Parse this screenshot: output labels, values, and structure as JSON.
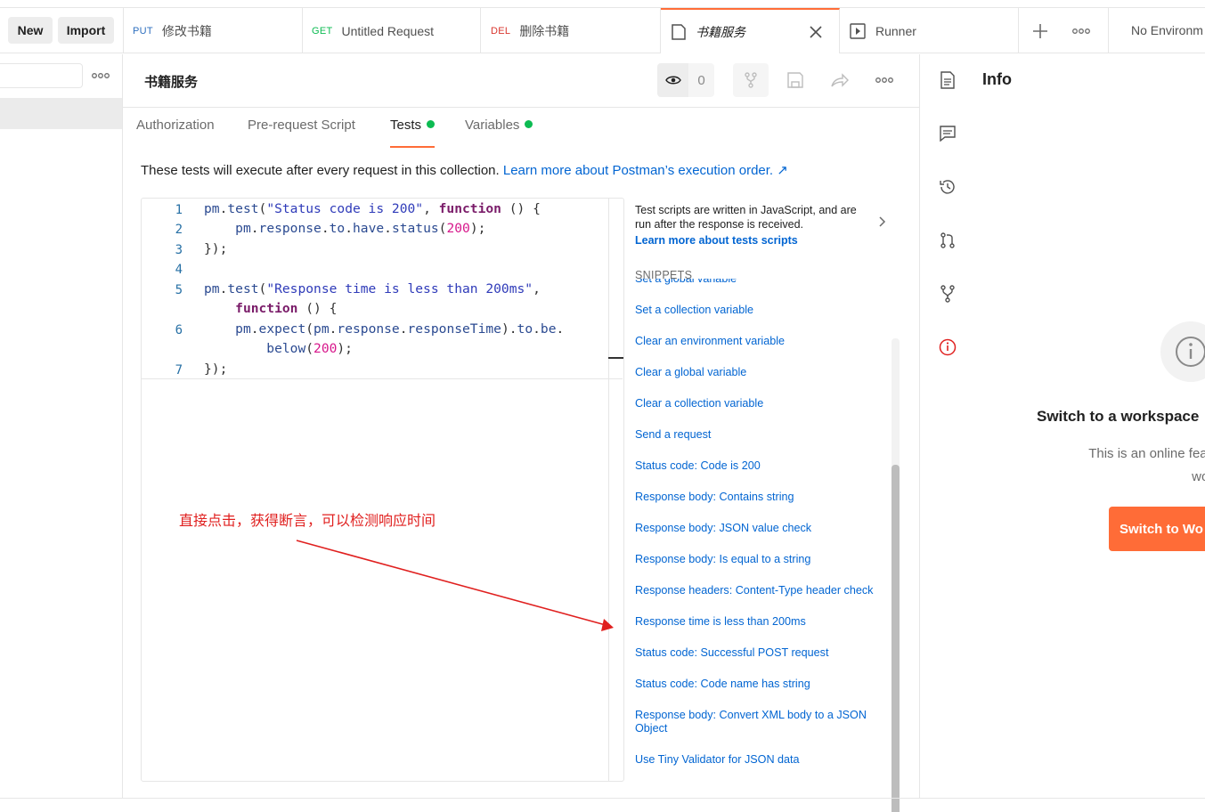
{
  "toolbar": {
    "new_label": "New",
    "import_label": "Import"
  },
  "tabs": [
    {
      "method": "PUT",
      "method_color": "#2e6fbf",
      "name": "修改书籍"
    },
    {
      "method": "GET",
      "method_color": "#0cbb52",
      "name": "Untitled Request"
    },
    {
      "method": "DEL",
      "method_color": "#d9362e",
      "name": "删除书籍"
    },
    {
      "method": "",
      "name": "书籍服务",
      "active": true
    },
    {
      "method": "",
      "name": "Runner"
    }
  ],
  "environment": {
    "label": "No Environm"
  },
  "collection": {
    "title": "书籍服务",
    "watch_count": "0"
  },
  "subtabs": [
    {
      "label": "Authorization"
    },
    {
      "label": "Pre-request Script"
    },
    {
      "label": "Tests",
      "active": true
    },
    {
      "label": "Variables"
    }
  ],
  "description": {
    "text": "These tests will execute after every request in this collection. ",
    "link": "Learn more about Postman’s execution order. ↗"
  },
  "editor": {
    "line_numbers": [
      "1",
      "2",
      "3",
      "4",
      "5",
      "6",
      "7"
    ]
  },
  "snippets": {
    "intro": "Test scripts are written in JavaScript, and are run after the response is received.",
    "intro_link": "Learn more about tests scripts",
    "heading": "SNIPPETS",
    "items": [
      "Set a global variable",
      "Set a collection variable",
      "Clear an environment variable",
      "Clear a global variable",
      "Clear a collection variable",
      "Send a request",
      "Status code: Code is 200",
      "Response body: Contains string",
      "Response body: JSON value check",
      "Response body: Is equal to a string",
      "Response headers: Content-Type header check",
      "Response time is less than 200ms",
      "Status code: Successful POST request",
      "Status code: Code name has string",
      "Response body: Convert XML body to a JSON Object",
      "Use Tiny Validator for JSON data"
    ]
  },
  "annotation": {
    "text": "直接点击，获得断言，可以检测响应时间",
    "color": "#e0201f"
  },
  "info_panel": {
    "title": "Info",
    "heading": "Switch to a workspace",
    "body_line1": "This is an online feature a",
    "body_line2": "workspa",
    "button": "Switch to Wo"
  },
  "colors": {
    "accent": "#ff6c37",
    "link": "#0265d2",
    "green_dot": "#0cbb52"
  }
}
